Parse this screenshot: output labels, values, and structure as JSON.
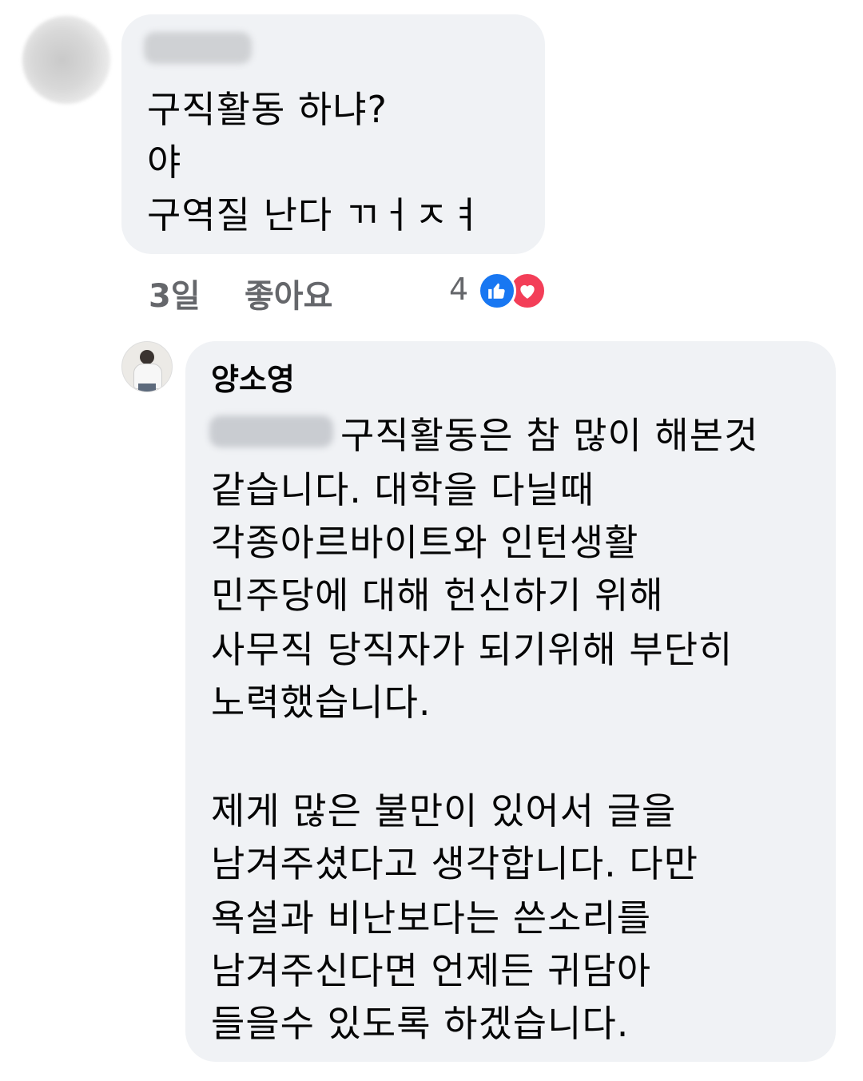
{
  "parent_comment": {
    "lines": [
      "구직활동 하냐?",
      "야",
      "구역질 난다 ㄲㅓㅈㅕ"
    ],
    "time": "3일",
    "like_label": "좋아요",
    "reaction_count": "4",
    "reactions": [
      "like-icon",
      "love-icon"
    ]
  },
  "reply": {
    "author": "양소영",
    "lines": [
      "구직활동은 참 많이 해본것",
      "같습니다. 대학을 다닐때",
      "각종아르바이트와 인턴생활",
      "민주당에 대해 헌신하기 위해",
      "사무직 당직자가 되기위해 부단히",
      "노력했습니다.",
      "제게 많은 불만이 있어서 글을",
      "남겨주셨다고 생각합니다. 다만",
      "욕설과 비난보다는 쓴소리를",
      "남겨주신다면 언제든 귀담아",
      "들을수 있도록 하겠습니다."
    ]
  },
  "colors": {
    "bubble": "#f0f2f5",
    "meta_text": "#65676b",
    "like": "#1877f2",
    "love": "#f33e58"
  }
}
